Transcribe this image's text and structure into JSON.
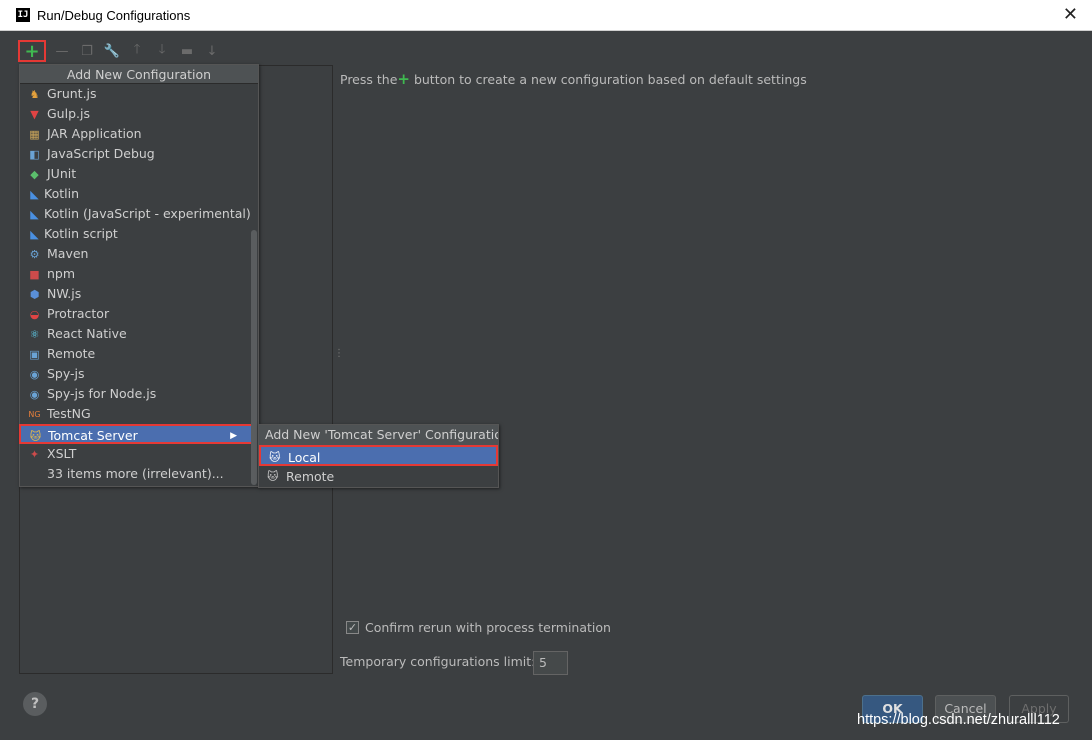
{
  "window": {
    "title": "Run/Debug Configurations",
    "logo": "IJ"
  },
  "toolbar": {
    "add_icon": "+",
    "remove_icon": "—",
    "copy_icon": "❐",
    "edit_defaults_icon": "🔧",
    "move_up_icon": "🡑",
    "move_down_icon": "🡓",
    "folder_icon": "▬",
    "sort_icon": "↓"
  },
  "hint": {
    "prefix": "Press the",
    "suffix": " button to create a new configuration based on default settings"
  },
  "dropdown": {
    "header": "Add New Configuration",
    "items": [
      {
        "label": "Grunt.js",
        "icon": "grunt-icon",
        "glyph": "♞",
        "color": "#e6a23c"
      },
      {
        "label": "Gulp.js",
        "icon": "gulp-icon",
        "glyph": "▼",
        "color": "#e04444"
      },
      {
        "label": "JAR Application",
        "icon": "jar-icon",
        "glyph": "▦",
        "color": "#c9a45a"
      },
      {
        "label": "JavaScript Debug",
        "icon": "js-debug-icon",
        "glyph": "◧",
        "color": "#6aa3d5"
      },
      {
        "label": "JUnit",
        "icon": "junit-icon",
        "glyph": "◆",
        "color": "#5bbf6c"
      },
      {
        "label": "Kotlin",
        "icon": "kotlin-icon",
        "glyph": "◣",
        "color": "#4a90e2"
      },
      {
        "label": "Kotlin (JavaScript - experimental)",
        "icon": "kotlin-js-icon",
        "glyph": "◣",
        "color": "#4a90e2"
      },
      {
        "label": "Kotlin script",
        "icon": "kotlin-script-icon",
        "glyph": "◣",
        "color": "#4a90e2"
      },
      {
        "label": "Maven",
        "icon": "maven-gear-icon",
        "glyph": "⚙",
        "color": "#6aa3d5"
      },
      {
        "label": "npm",
        "icon": "npm-icon",
        "glyph": "■",
        "color": "#cc4b4b"
      },
      {
        "label": "NW.js",
        "icon": "nwjs-icon",
        "glyph": "⬢",
        "color": "#5a8fd8"
      },
      {
        "label": "Protractor",
        "icon": "protractor-icon",
        "glyph": "◒",
        "color": "#e04444"
      },
      {
        "label": "React Native",
        "icon": "react-icon",
        "glyph": "⚛",
        "color": "#61dafb"
      },
      {
        "label": "Remote",
        "icon": "remote-icon",
        "glyph": "▣",
        "color": "#6aa3d5"
      },
      {
        "label": "Spy-js",
        "icon": "spyjs-icon",
        "glyph": "◉",
        "color": "#6aa3d5"
      },
      {
        "label": "Spy-js for Node.js",
        "icon": "spyjs-node-icon",
        "glyph": "◉",
        "color": "#6aa3d5"
      },
      {
        "label": "TestNG",
        "icon": "testng-icon",
        "glyph": "NG",
        "color": "#e57e3c"
      },
      {
        "label": "Tomcat Server",
        "icon": "tomcat-icon",
        "glyph": "🐱",
        "color": "#f0c040"
      },
      {
        "label": "XSLT",
        "icon": "xslt-icon",
        "glyph": "✦",
        "color": "#cc4b4b"
      },
      {
        "label": "33 items more (irrelevant)...",
        "icon": "",
        "glyph": "",
        "color": "#cfcfcf"
      }
    ],
    "submenu_arrow": "▶"
  },
  "submenu": {
    "header": "Add New 'Tomcat Server' Configuration",
    "items": [
      {
        "label": "Local",
        "glyph": "🐱"
      },
      {
        "label": "Remote",
        "glyph": "🐱"
      }
    ]
  },
  "options": {
    "confirm_rerun_label": "Confirm rerun with process termination",
    "confirm_checked": "✓",
    "temp_limit_label": "Temporary configurations limit:",
    "temp_limit_value": "5"
  },
  "footer": {
    "help": "?",
    "ok": "OK",
    "cancel": "Cancel",
    "apply": "Apply"
  },
  "watermark": "https://blog.csdn.net/zhuralll112",
  "colors": {
    "accent_selected": "#4b6eaf",
    "highlight_box": "#e53935",
    "add_green": "#3fb950"
  }
}
